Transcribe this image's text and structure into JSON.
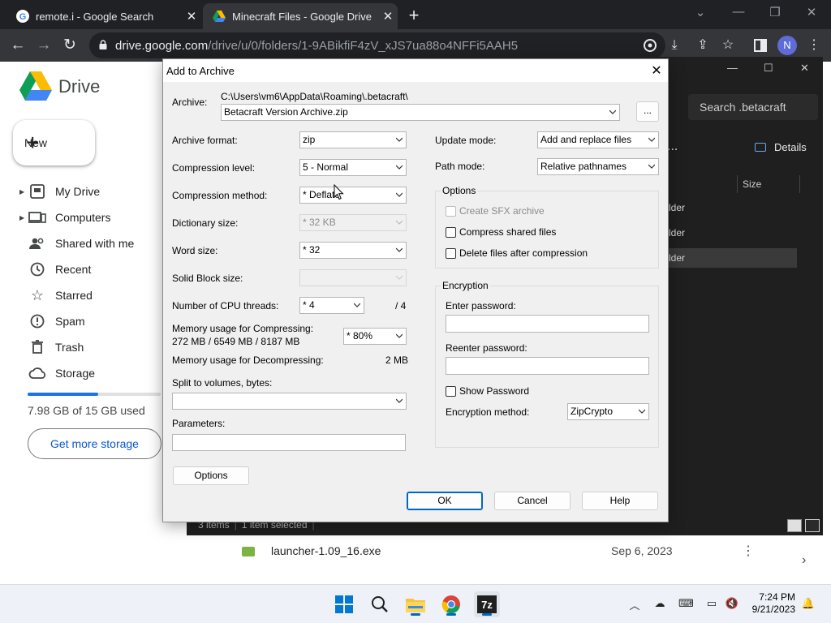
{
  "browser": {
    "tabs": [
      {
        "title": "remote.i - Google Search",
        "favicon": "google-icon"
      },
      {
        "title": "Minecraft Files - Google Drive",
        "favicon": "drive-icon"
      }
    ],
    "url_host": "drive.google.com",
    "url_path": "/drive/u/0/folders/1-9ABikfiF4zV_xJS7ua88o4NFFi5AAH5",
    "profile_initial": "N"
  },
  "drive": {
    "app_name": "Drive",
    "new_label": "New",
    "nav": [
      {
        "label": "My Drive",
        "icon": "my-drive-icon",
        "expandable": true
      },
      {
        "label": "Computers",
        "icon": "computers-icon",
        "expandable": true
      },
      {
        "label": "Shared with me",
        "icon": "people-icon",
        "expandable": false
      },
      {
        "label": "Recent",
        "icon": "clock-icon",
        "expandable": false
      },
      {
        "label": "Starred",
        "icon": "star-icon",
        "expandable": false
      },
      {
        "label": "Spam",
        "icon": "spam-icon",
        "expandable": false
      },
      {
        "label": "Trash",
        "icon": "trash-icon",
        "expandable": false
      },
      {
        "label": "Storage",
        "icon": "cloud-icon",
        "expandable": false
      }
    ],
    "storage_used_fraction": 0.532,
    "storage_text": "7.98 GB of 15 GB used",
    "get_more_storage": "Get more storage",
    "file_row": {
      "name": "launcher-1.09_16.exe",
      "date": "Sep 6, 2023"
    }
  },
  "explorer": {
    "search_placeholder": "Search .betacraft",
    "details_label": "Details",
    "dots": "...",
    "size_header": "Size",
    "rows": [
      "lder",
      "lder",
      "lder"
    ],
    "status_items": "3 items",
    "status_selected": "1 item selected",
    "status_sep": "|"
  },
  "dialog": {
    "title": "Add to Archive",
    "archive_label": "Archive:",
    "archive_path": "C:\\Users\\vm6\\AppData\\Roaming\\.betacraft\\",
    "archive_name": "Betacraft Version Archive.zip",
    "browse_label": "...",
    "left": {
      "archive_format": {
        "label": "Archive format:",
        "value": "zip"
      },
      "compression_level": {
        "label": "Compression level:",
        "value": "5 - Normal"
      },
      "compression_method": {
        "label": "Compression method:",
        "value": "* Deflate"
      },
      "dictionary_size": {
        "label": "Dictionary size:",
        "value": "* 32 KB"
      },
      "word_size": {
        "label": "Word size:",
        "value": "* 32"
      },
      "solid_block": {
        "label": "Solid Block size:",
        "value": ""
      },
      "cpu_threads": {
        "label": "Number of CPU threads:",
        "value": "* 4",
        "max": "/ 4"
      },
      "mem_compress_label": "Memory usage for Compressing:",
      "mem_compress_value": "272 MB / 6549 MB / 8187 MB",
      "mem_percent": "* 80%",
      "mem_decompress_label": "Memory usage for Decompressing:",
      "mem_decompress_value": "2 MB",
      "split_label": "Split to volumes, bytes:",
      "split_value": "",
      "parameters_label": "Parameters:",
      "parameters_value": "",
      "options_button": "Options"
    },
    "right": {
      "update_mode": {
        "label": "Update mode:",
        "value": "Add and replace files"
      },
      "path_mode": {
        "label": "Path mode:",
        "value": "Relative pathnames"
      },
      "options_group": "Options",
      "create_sfx": "Create SFX archive",
      "compress_shared": "Compress shared files",
      "delete_after": "Delete files after compression",
      "encryption_group": "Encryption",
      "enter_password": "Enter password:",
      "reenter_password": "Reenter password:",
      "show_password": "Show Password",
      "encryption_method_label": "Encryption method:",
      "encryption_method_value": "ZipCrypto"
    },
    "buttons": {
      "ok": "OK",
      "cancel": "Cancel",
      "help": "Help"
    }
  },
  "taskbar": {
    "apps": [
      "windows-start-icon",
      "search-icon",
      "file-explorer-icon",
      "chrome-icon",
      "7zip-icon"
    ],
    "time": "7:24 PM",
    "date": "9/21/2023"
  }
}
